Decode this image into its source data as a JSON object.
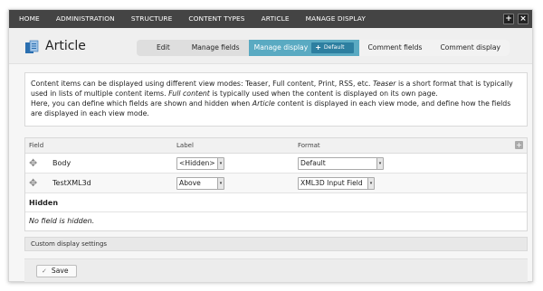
{
  "toolbar": {
    "items": [
      "HOME",
      "ADMINISTRATION",
      "STRUCTURE",
      "CONTENT TYPES",
      "ARTICLE",
      "MANAGE DISPLAY"
    ],
    "add_label": "+",
    "close_label": "×"
  },
  "header": {
    "title": "Article",
    "tabs": {
      "edit": "Edit",
      "manage_fields": "Manage fields",
      "manage_display": "Manage display",
      "sub_tab_plus": "+",
      "sub_tab_default": "Default",
      "comment_fields": "Comment fields",
      "comment_display": "Comment display"
    }
  },
  "help": {
    "p1_a": "Content items can be displayed using different view modes: Teaser, Full content, Print, RSS, etc. ",
    "p1_teaser": "Teaser",
    "p1_b": " is a short format that is typically used in lists of multiple content items. ",
    "p1_full": "Full content",
    "p1_c": " is typically used when the content is displayed on its own page.",
    "p2_a": "Here, you can define which fields are shown and hidden when ",
    "p2_article": "Article",
    "p2_b": " content is displayed in each view mode, and define how the fields are displayed in each view mode."
  },
  "table": {
    "headers": {
      "field": "Field",
      "label": "Label",
      "format": "Format"
    },
    "rows": [
      {
        "field": "Body",
        "label": "<Hidden>",
        "format": "Default"
      },
      {
        "field": "TestXML3d",
        "label": "Above",
        "format": "XML3D Input Field"
      }
    ],
    "hidden_title": "Hidden",
    "hidden_empty": "No field is hidden.",
    "arrow": "▾"
  },
  "custom_display": "Custom display settings",
  "save": {
    "label": "Save",
    "check": "✓"
  },
  "colors": {
    "toolbar": "#444444",
    "active_tab": "#5aaac2",
    "sub_tab": "#2d7fa0"
  }
}
